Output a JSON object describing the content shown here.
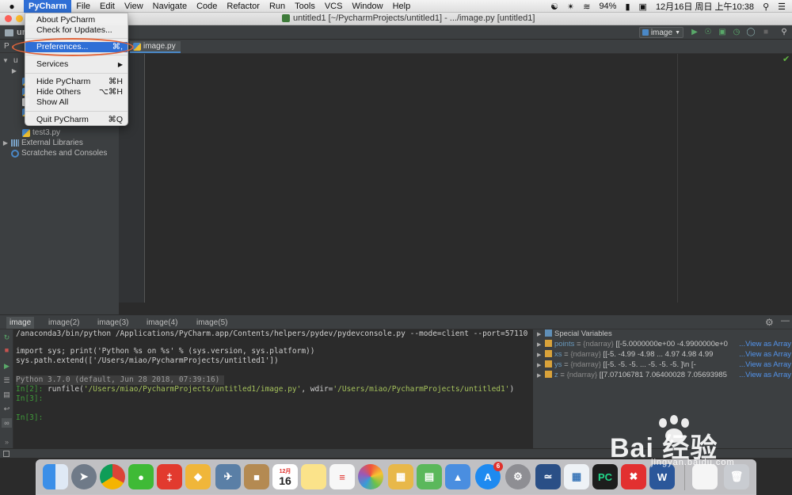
{
  "menubar": {
    "apple": "",
    "items": [
      "PyCharm",
      "File",
      "Edit",
      "View",
      "Navigate",
      "Code",
      "Refactor",
      "Run",
      "Tools",
      "VCS",
      "Window",
      "Help"
    ],
    "status": {
      "battery": "94%",
      "datetime": "12月16日 周日 上午10:38"
    }
  },
  "window": {
    "title": "untitled1 [~/PycharmProjects/untitled1] - .../image.py [untitled1]"
  },
  "navbar": {
    "project": "un",
    "run_config": "image"
  },
  "app_menu": {
    "about": "About PyCharm",
    "updates": "Check for Updates...",
    "preferences": "Preferences...",
    "preferences_shortcut": "⌘,",
    "services": "Services",
    "hide": "Hide PyCharm",
    "hide_shortcut": "⌘H",
    "hide_others": "Hide Others",
    "hide_others_shortcut": "⌥⌘H",
    "show_all": "Show All",
    "quit": "Quit PyCharm",
    "quit_shortcut": "⌘Q"
  },
  "project_tree": {
    "header": "P",
    "root_label": "u",
    "file_test3": "test3.py",
    "external_libraries": "External Libraries",
    "scratches": "Scratches and Consoles"
  },
  "editor": {
    "tab": "image.py"
  },
  "console": {
    "tabs": [
      "image",
      "image(2)",
      "image(3)",
      "image(4)",
      "image(5)"
    ],
    "lines": {
      "cmd": "/anaconda3/bin/python /Applications/PyCharm.app/Contents/helpers/pydev/pydevconsole.py --mode=client --port=57110",
      "import": "import sys; print('Python %s on %s' % (sys.version, sys.platform))",
      "extend": "sys.path.extend(['/Users/miao/PycharmProjects/untitled1'])",
      "version": "Python 3.7.0 (default, Jun 28 2018, 07:39:16) ",
      "in2": "In[2]:",
      "runfile_a": " runfile(",
      "runfile_path": "'/Users/miao/PycharmProjects/untitled1/image.py'",
      "runfile_b": ", wdir=",
      "runfile_wdir": "'/Users/miao/PycharmProjects/untitled1'",
      "runfile_c": ")",
      "in3a": "In[3]:",
      "in3b": "In[3]:"
    }
  },
  "variables": {
    "special": "Special Variables",
    "items": [
      {
        "name": "points",
        "type": "{ndarray}",
        "value": "[[-5.0000000e+00 -4.9900000e+0",
        "link": "...View as Array"
      },
      {
        "name": "xs",
        "type": "{ndarray}",
        "value": "[[-5.    -4.99 -4.98 ...  4.97  4.98  4.99",
        "link": "...View as Array"
      },
      {
        "name": "ys",
        "type": "{ndarray}",
        "value": "[[-5.    -5.    -5.   ... -5.    -5.    -5.  ]\\n [-",
        "link": "...View as Array"
      },
      {
        "name": "z",
        "type": "{ndarray}",
        "value": "[[7.07106781 7.06400028 7.05693985",
        "link": "...View as Array"
      }
    ]
  },
  "dock": {
    "calendar_month": "12月",
    "calendar_day": "16",
    "appstore_badge": "6"
  },
  "watermark": {
    "brand": "Bai 经验",
    "url": "jingyan.baidu.com"
  },
  "colors": {
    "menu_highlight": "#2f6fd6",
    "oval": "#e1653b",
    "prompt_green": "#3f9a3a",
    "link_blue": "#5394ec"
  }
}
